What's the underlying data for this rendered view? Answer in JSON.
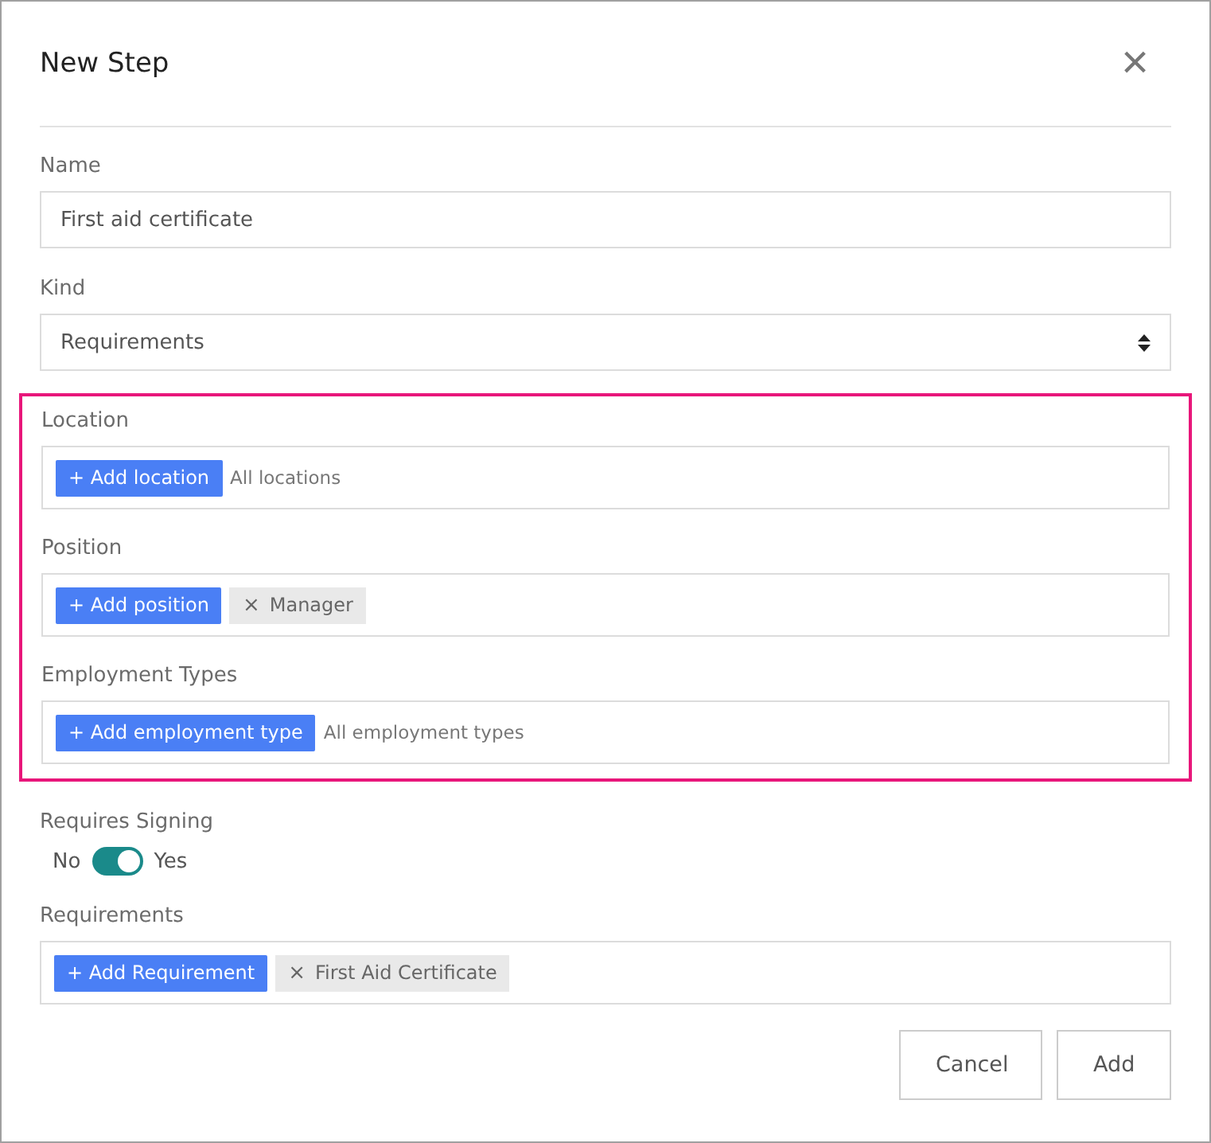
{
  "dialog": {
    "title": "New Step",
    "close_icon": "×"
  },
  "fields": [
    {
      "kind": "text",
      "label": "Name",
      "value": "First aid certificate"
    },
    {
      "kind": "select",
      "label": "Kind",
      "value": "Requirements"
    },
    {
      "kind": "group",
      "highlighted": true,
      "fields": [
        {
          "kind": "tags",
          "label": "Location",
          "button": "+ Add location",
          "placeholder": "All locations"
        },
        {
          "kind": "tags",
          "label": "Position",
          "button": "+ Add position",
          "tags": [
            {
              "label": "Manager",
              "remove": "×"
            }
          ]
        },
        {
          "kind": "tags",
          "label": "Employment Types",
          "button": "+ Add employment type",
          "placeholder": "All employment types"
        }
      ]
    },
    {
      "kind": "toggle",
      "label": "Requires Signing",
      "off_label": "No",
      "on_label": "Yes",
      "on": true
    },
    {
      "kind": "tags",
      "label": "Requirements",
      "button": "+ Add Requirement",
      "tags": [
        {
          "label": "First Aid Certificate",
          "remove": "×"
        }
      ]
    }
  ],
  "buttons": [
    "Cancel",
    "Add"
  ]
}
